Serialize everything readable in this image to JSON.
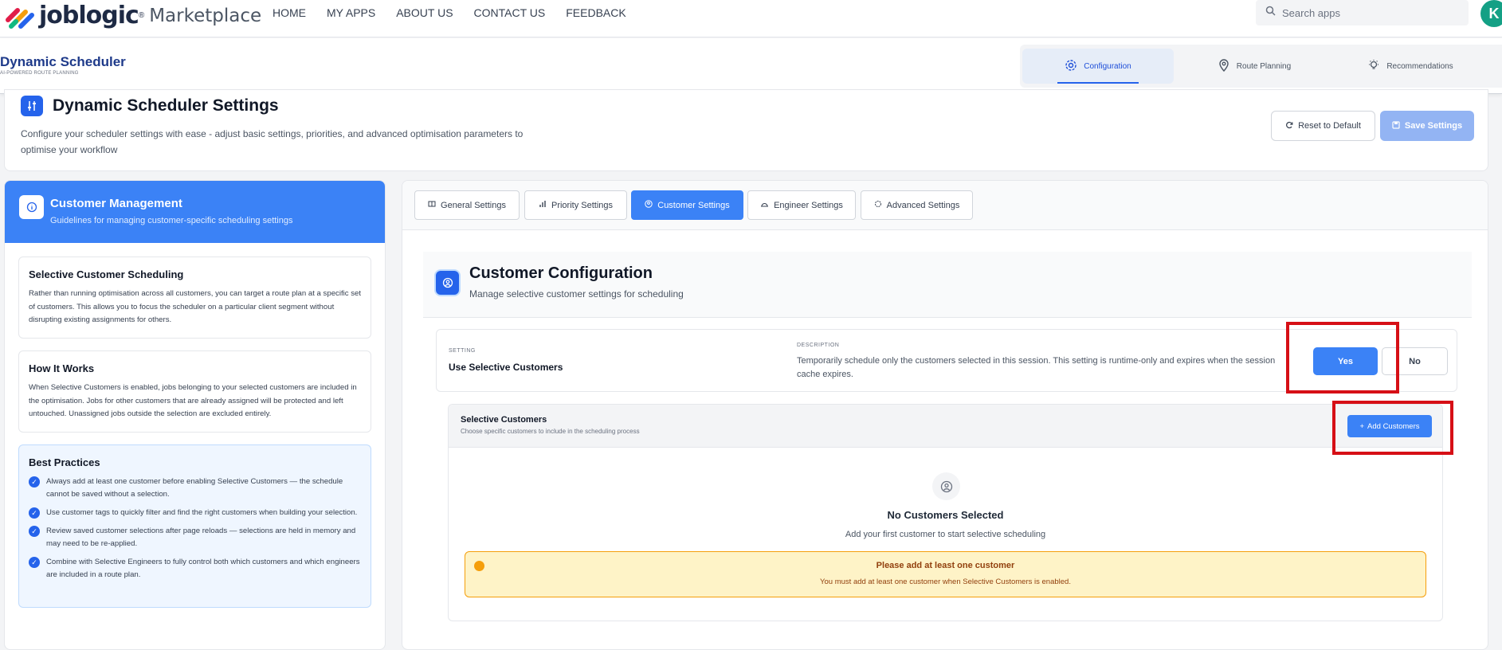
{
  "brand": {
    "name": "joblogic",
    "product": "Marketplace"
  },
  "nav": {
    "items": [
      "HOME",
      "MY APPS",
      "ABOUT US",
      "CONTACT US",
      "FEEDBACK"
    ]
  },
  "search": {
    "placeholder": "Search apps"
  },
  "user": {
    "initial": "K"
  },
  "app": {
    "title": "Dynamic Scheduler",
    "subtitle": "AI-POWERED ROUTE PLANNING"
  },
  "modes": [
    "Configuration",
    "Route Planning",
    "Recommendations"
  ],
  "settings": {
    "title": "Dynamic Scheduler Settings",
    "description": "Configure your scheduler settings with ease - adjust basic settings, priorities, and advanced optimisation parameters to optimise your workflow",
    "reset_label": "Reset to Default",
    "save_label": "Save Settings"
  },
  "guide": {
    "title": "Customer Management",
    "subtitle": "Guidelines for managing customer-specific scheduling settings",
    "sections": [
      {
        "title": "Selective Customer Scheduling",
        "body": "Rather than running optimisation across all customers, you can target a route plan at a specific set of customers. This allows you to focus the scheduler on a particular client segment without disrupting existing assignments for others."
      },
      {
        "title": "How It Works",
        "body": "When Selective Customers is enabled, jobs belonging to your selected customers are included in the optimisation. Jobs for other customers that are already assigned will be protected and left untouched. Unassigned jobs outside the selection are excluded entirely."
      }
    ],
    "best_practices": {
      "title": "Best Practices",
      "items": [
        "Always add at least one customer before enabling Selective Customers — the schedule cannot be saved without a selection.",
        "Use customer tags to quickly filter and find the right customers when building your selection.",
        "Review saved customer selections after page reloads — selections are held in memory and may need to be re-applied.",
        "Combine with Selective Engineers to fully control both which customers and which engineers are included in a route plan."
      ]
    }
  },
  "tabs": [
    "General Settings",
    "Priority Settings",
    "Customer Settings",
    "Engineer Settings",
    "Advanced Settings"
  ],
  "active_tab": "Customer Settings",
  "customer_config": {
    "title": "Customer Configuration",
    "subtitle": "Manage selective customer settings for scheduling",
    "setting_caption": "SETTING",
    "setting_label": "Use Selective Customers",
    "description_caption": "DESCRIPTION",
    "description": "Temporarily schedule only the customers selected in this session. This setting is runtime-only and expires when the session cache expires.",
    "yes_label": "Yes",
    "no_label": "No",
    "selected_value": "Yes"
  },
  "selective_customers": {
    "title": "Selective Customers",
    "subtitle": "Choose specific customers to include in the scheduling process",
    "add_label": "Add Customers",
    "empty_title": "No Customers Selected",
    "empty_sub": "Add your first customer to start selective scheduling",
    "warning_title": "Please add at least one customer",
    "warning_body": "You must add at least one customer when Selective Customers is enabled."
  },
  "colors": {
    "primary": "#3b82f6",
    "brand_dark": "#1e3a8a",
    "warning_bg": "#fef3c7",
    "warning_border": "#f59e0b",
    "highlight": "#d60f16"
  }
}
